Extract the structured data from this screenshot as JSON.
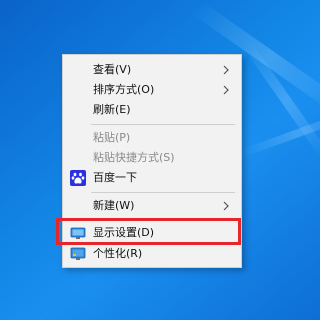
{
  "menu": {
    "items": [
      {
        "label": "查看(V)",
        "submenu": true,
        "enabled": true
      },
      {
        "label": "排序方式(O)",
        "submenu": true,
        "enabled": true
      },
      {
        "label": "刷新(E)",
        "submenu": false,
        "enabled": true
      },
      {
        "label": "粘贴(P)",
        "submenu": false,
        "enabled": false
      },
      {
        "label": "粘贴快捷方式(S)",
        "submenu": false,
        "enabled": false
      },
      {
        "label": "百度一下",
        "submenu": false,
        "enabled": true,
        "icon": "baidu-paw-icon"
      },
      {
        "label": "新建(W)",
        "submenu": true,
        "enabled": true
      },
      {
        "label": "显示设置(D)",
        "submenu": false,
        "enabled": true,
        "icon": "display-settings-icon"
      },
      {
        "label": "个性化(R)",
        "submenu": false,
        "enabled": true,
        "icon": "personalize-icon"
      }
    ]
  },
  "highlight_color": "#e7262c",
  "desktop_color": "#1387e6",
  "baidu_icon_color": "#2932e1"
}
